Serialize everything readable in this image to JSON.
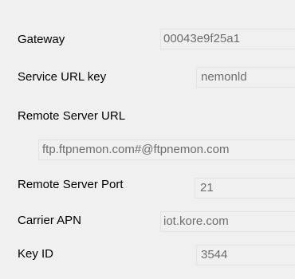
{
  "form": {
    "gateway": {
      "label": "Gateway",
      "value": "00043e9f25a1"
    },
    "service_url_key": {
      "label": "Service URL key",
      "value": "nemonld"
    },
    "remote_server_url": {
      "label": "Remote Server URL",
      "value": "ftp.ftpnemon.com#@ftpnemon.com"
    },
    "remote_server_port": {
      "label": "Remote Server Port",
      "value": "21"
    },
    "carrier_apn": {
      "label": "Carrier APN",
      "value": "iot.kore.com"
    },
    "key_id": {
      "label": "Key ID",
      "value": "3544"
    }
  }
}
